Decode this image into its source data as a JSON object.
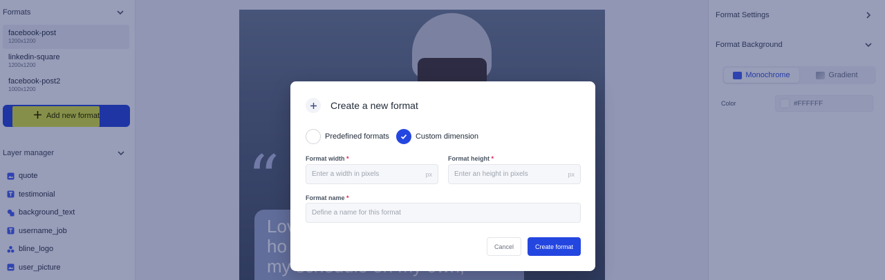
{
  "sidebar": {
    "formats_header": "Formats",
    "formats": [
      {
        "name": "facebook-post",
        "size": "1200x1200"
      },
      {
        "name": "linkedin-square",
        "size": "1200x1200"
      },
      {
        "name": "facebook-post2",
        "size": "1000x1200"
      }
    ],
    "add_format_label": "Add new format",
    "layer_header": "Layer manager",
    "layers": [
      {
        "name": "quote",
        "icon": "image-icon"
      },
      {
        "name": "testimonial",
        "icon": "text-icon"
      },
      {
        "name": "background_text",
        "icon": "shapes-icon"
      },
      {
        "name": "username_job",
        "icon": "text-icon"
      },
      {
        "name": "bline_logo",
        "icon": "group-icon"
      },
      {
        "name": "user_picture",
        "icon": "image-icon"
      }
    ]
  },
  "canvas": {
    "quote_mark": "“",
    "quote_text_lines": [
      "Lov",
      "ho",
      "my schedule on my own,"
    ]
  },
  "right_panel": {
    "format_settings": "Format Settings",
    "format_background": "Format Background",
    "mode_options": [
      "Monochrome",
      "Gradient"
    ],
    "active_mode": "Monochrome",
    "color_label": "Color",
    "color_value": "#FFFFFF"
  },
  "modal": {
    "title": "Create a new format",
    "options": {
      "predefined": "Predefined formats",
      "custom": "Custom dimension"
    },
    "selected_option": "custom",
    "width_label": "Format width",
    "width_placeholder": "Enter a width in pixels",
    "height_label": "Format height",
    "height_placeholder": "Enter an height in pixels",
    "unit": "px",
    "name_label": "Format name",
    "name_placeholder": "Define a name for this format",
    "required_mark": "*",
    "cancel_label": "Cancel",
    "create_label": "Create format"
  },
  "colors": {
    "primary": "#2446e0",
    "highlight": "#e9ef2a",
    "overlay": "rgba(30,42,100,0.46)"
  }
}
